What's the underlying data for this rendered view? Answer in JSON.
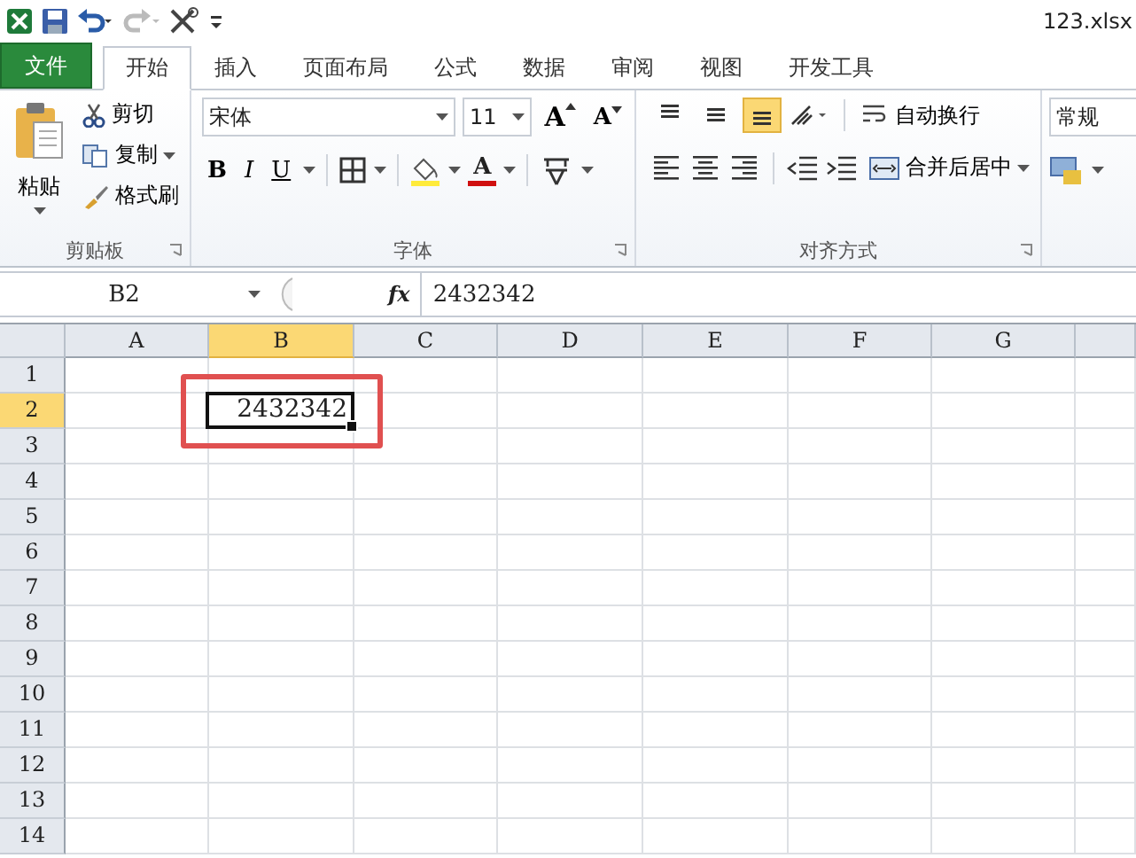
{
  "window": {
    "title": "123.xlsx"
  },
  "tabs": [
    {
      "label": "文件",
      "kind": "file",
      "selected": false
    },
    {
      "label": "开始",
      "kind": "tab",
      "selected": true
    },
    {
      "label": "插入",
      "kind": "tab",
      "selected": false
    },
    {
      "label": "页面布局",
      "kind": "tab",
      "selected": false
    },
    {
      "label": "公式",
      "kind": "tab",
      "selected": false
    },
    {
      "label": "数据",
      "kind": "tab",
      "selected": false
    },
    {
      "label": "审阅",
      "kind": "tab",
      "selected": false
    },
    {
      "label": "视图",
      "kind": "tab",
      "selected": false
    },
    {
      "label": "开发工具",
      "kind": "tab",
      "selected": false
    }
  ],
  "clipboard": {
    "paste": "粘贴",
    "cut": "剪切",
    "copy": "复制",
    "format_painter": "格式刷",
    "label": "剪贴板"
  },
  "font": {
    "name": "宋体",
    "size": "11",
    "grow": "A",
    "shrink": "A",
    "bold": "B",
    "italic": "I",
    "underline": "U",
    "font_color_letter": "A",
    "label": "字体"
  },
  "alignment": {
    "vertical": [
      {
        "selected": false
      },
      {
        "selected": false
      },
      {
        "selected": true
      }
    ],
    "wrap": "自动换行",
    "merge": "合并后居中",
    "label": "对齐方式"
  },
  "number": {
    "format": "常规"
  },
  "formula_bar": {
    "name_box": "B2",
    "fx": "fx",
    "value": "2432342"
  },
  "sheet": {
    "columns": [
      {
        "label": "A",
        "selected": false
      },
      {
        "label": "B",
        "selected": true
      },
      {
        "label": "C",
        "selected": false
      },
      {
        "label": "D",
        "selected": false
      },
      {
        "label": "E",
        "selected": false
      },
      {
        "label": "F",
        "selected": false
      },
      {
        "label": "G",
        "selected": false
      }
    ],
    "rows": [
      {
        "label": "1",
        "selected": false
      },
      {
        "label": "2",
        "selected": true
      },
      {
        "label": "3",
        "selected": false
      },
      {
        "label": "4",
        "selected": false
      },
      {
        "label": "5",
        "selected": false
      },
      {
        "label": "6",
        "selected": false
      },
      {
        "label": "7",
        "selected": false
      },
      {
        "label": "8",
        "selected": false
      },
      {
        "label": "9",
        "selected": false
      },
      {
        "label": "10",
        "selected": false
      },
      {
        "label": "11",
        "selected": false
      },
      {
        "label": "12",
        "selected": false
      },
      {
        "label": "13",
        "selected": false
      },
      {
        "label": "14",
        "selected": false
      }
    ],
    "active_cell": {
      "value": "2432342"
    }
  }
}
